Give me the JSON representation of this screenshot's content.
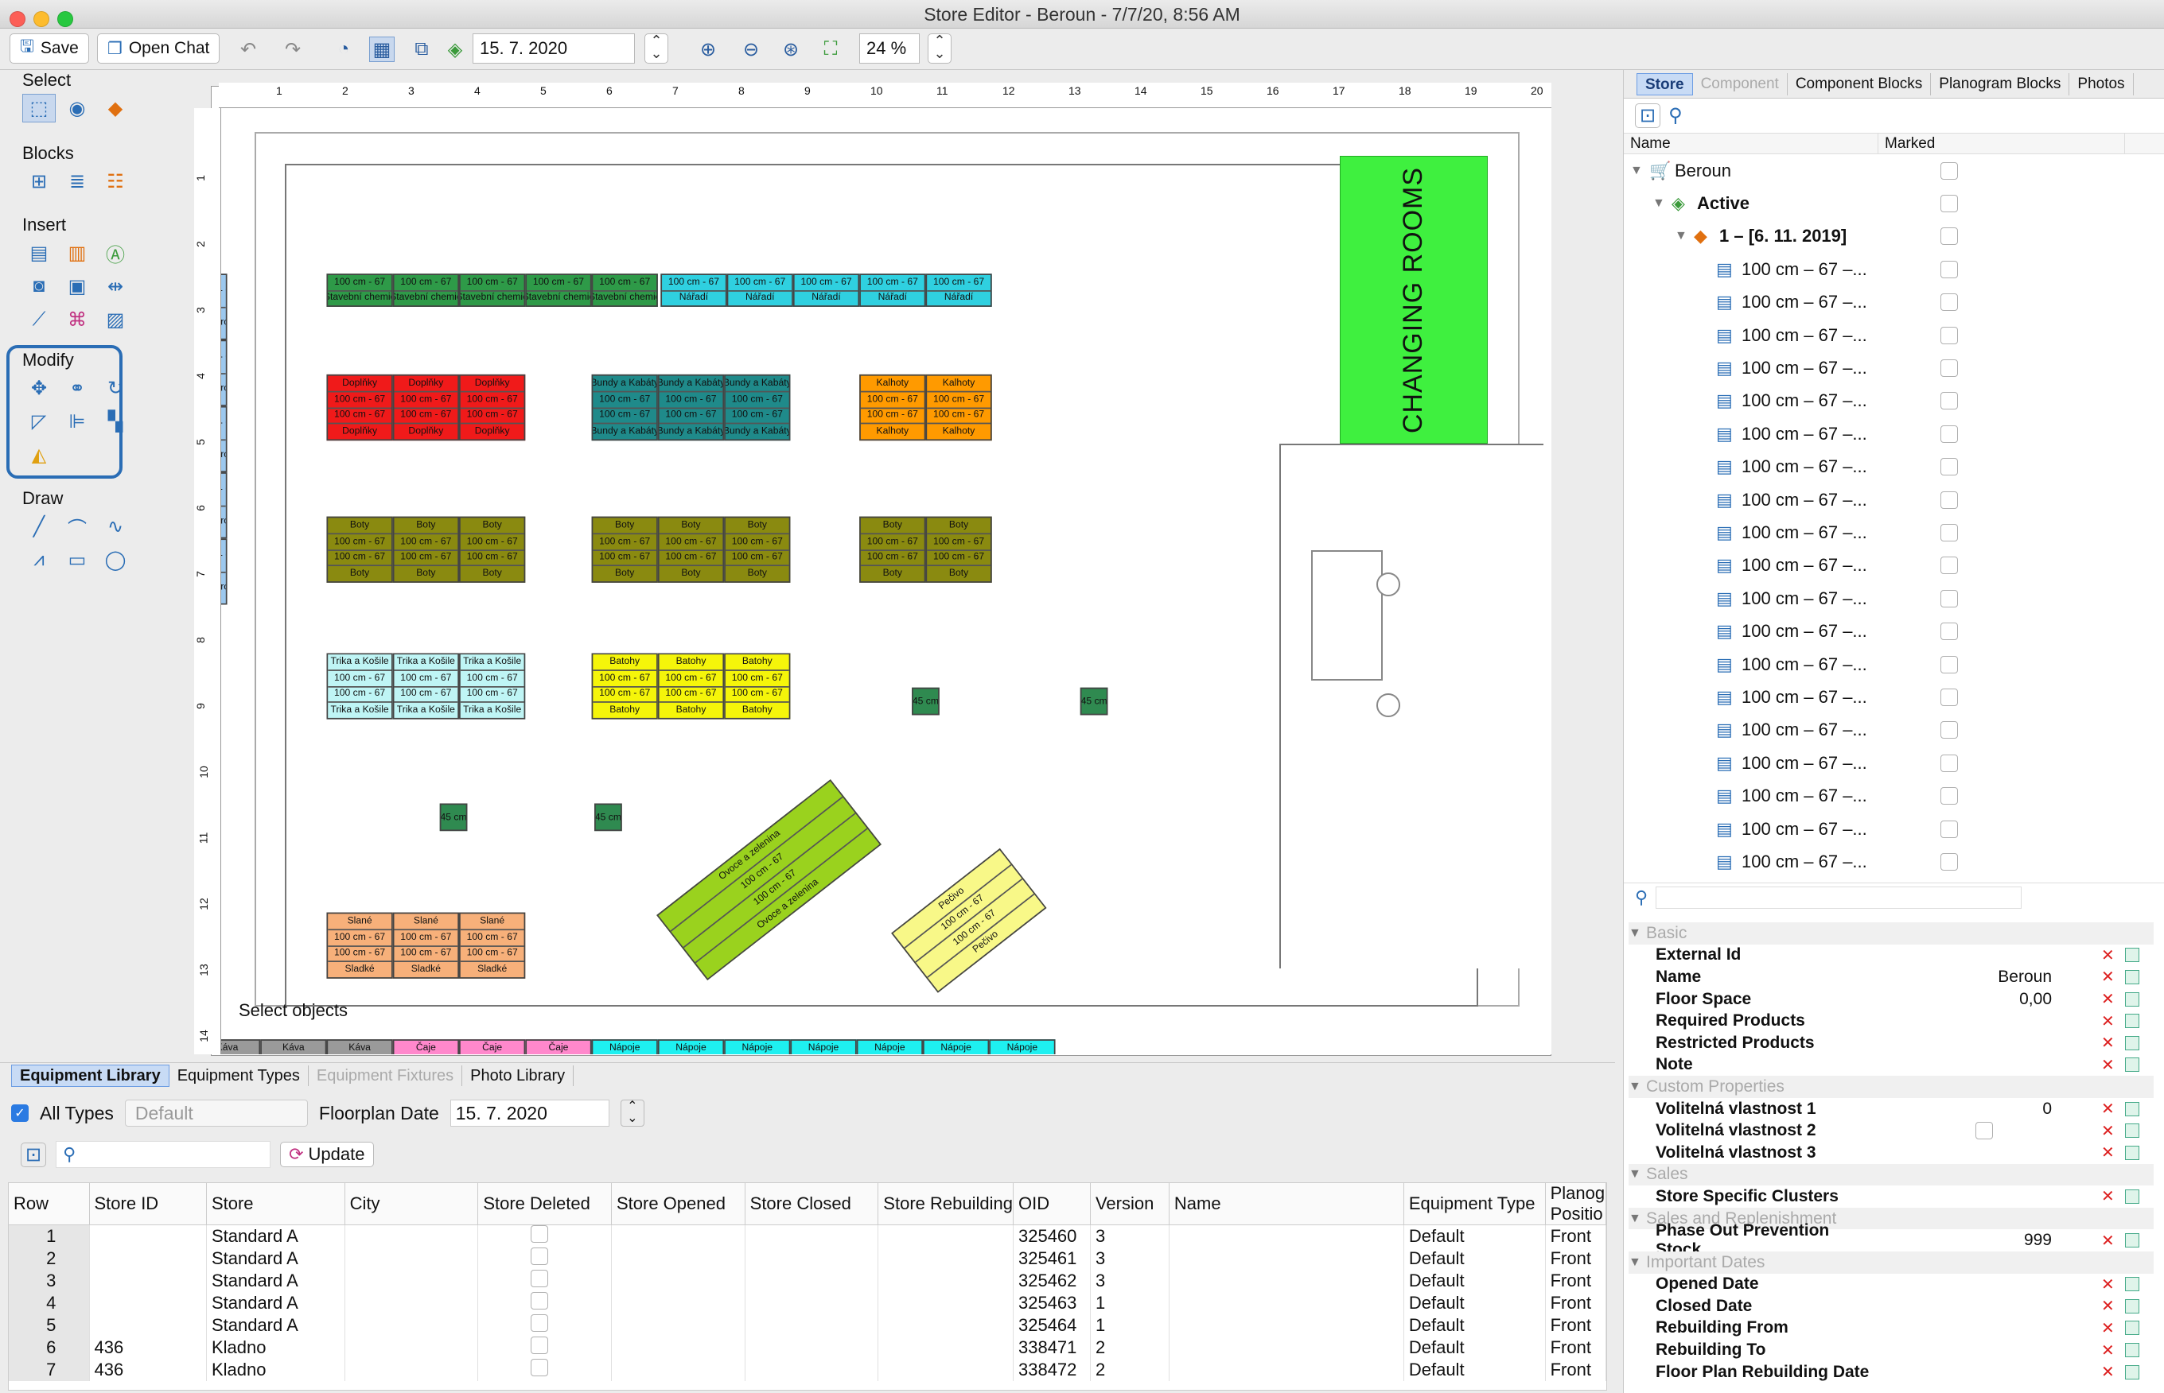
{
  "window": {
    "title": "Store Editor - Beroun - 7/7/20, 8:56 AM"
  },
  "toolbar": {
    "save": "Save",
    "open_chat": "Open Chat",
    "date": "15. 7. 2020",
    "zoom": "24 %"
  },
  "palette": {
    "select": "Select",
    "blocks": "Blocks",
    "insert": "Insert",
    "modify": "Modify",
    "draw": "Draw"
  },
  "canvas": {
    "status": "Select objects",
    "changing_rooms": "CHANGING ROOMS",
    "ruler_top": [
      "1",
      "2",
      "3",
      "4",
      "5",
      "6",
      "7",
      "8",
      "9",
      "10",
      "11",
      "12",
      "13",
      "14",
      "15",
      "16",
      "17",
      "18",
      "19",
      "20"
    ],
    "ruler_left": [
      "1",
      "2",
      "3",
      "4",
      "5",
      "6",
      "7",
      "8",
      "9",
      "10",
      "11",
      "12",
      "13",
      "14"
    ],
    "fixture_label": "100 cm - 67",
    "groups": {
      "chemie": "Stavební chemie",
      "naradi": "Nářadí",
      "doplnky": "Doplňky",
      "bundy": "Bundy a Kabáty",
      "kalhoty": "Kalhoty",
      "boty": "Boty",
      "trika": "Trika a Košile",
      "batohy": "Batohy",
      "slane": "Slané",
      "sladke": "Sladké",
      "kava": "Káva",
      "caje": "Čaje",
      "napoje": "Nápoje",
      "pecivo": "Pečivo",
      "ovoce": "Ovoce a zelenina",
      "mlecne": "Mléčné výrobky",
      "small": "45 cm"
    }
  },
  "right": {
    "tabs": [
      "Store",
      "Component",
      "Component Blocks",
      "Planogram Blocks",
      "Photos"
    ],
    "tree_cols": [
      "Name",
      "Marked"
    ],
    "tree": {
      "root": "Beroun",
      "active": "Active",
      "plan": "1 – [6. 11. 2019]",
      "item": "100 cm – 67 –..."
    },
    "props": [
      {
        "label": "Basic",
        "section": true
      },
      {
        "label": "External Id",
        "value": ""
      },
      {
        "label": "Name",
        "value": "Beroun"
      },
      {
        "label": "Floor Space",
        "value": "0,00"
      },
      {
        "label": "Required Products",
        "value": ""
      },
      {
        "label": "Restricted Products",
        "value": ""
      },
      {
        "label": "Note",
        "value": ""
      },
      {
        "label": "Custom Properties",
        "section": true
      },
      {
        "label": "Volitelná vlastnost 1",
        "value": "0"
      },
      {
        "label": "Volitelná vlastnost 2",
        "value": ""
      },
      {
        "label": "Volitelná vlastnost 3",
        "value": ""
      },
      {
        "label": "Sales",
        "section": true
      },
      {
        "label": "Store Specific Clusters",
        "value": ""
      },
      {
        "label": "Sales and Replenishment",
        "section": true
      },
      {
        "label": "Phase Out Prevention Stock",
        "value": "999"
      },
      {
        "label": "Important Dates",
        "section": true
      },
      {
        "label": "Opened Date",
        "value": ""
      },
      {
        "label": "Closed Date",
        "value": ""
      },
      {
        "label": "Rebuilding From",
        "value": ""
      },
      {
        "label": "Rebuilding To",
        "value": ""
      },
      {
        "label": "Floor Plan Rebuilding Date",
        "value": ""
      }
    ]
  },
  "bottom": {
    "tabs": [
      "Equipment Library",
      "Equipment Types",
      "Equipment Fixtures",
      "Photo Library"
    ],
    "all_types": "All Types",
    "default": "Default",
    "floorplan_date_label": "Floorplan Date",
    "floorplan_date": "15. 7. 2020",
    "update": "Update",
    "columns": [
      "Row",
      "Store ID",
      "Store",
      "City",
      "Store Deleted",
      "Store Opened",
      "Store Closed",
      "Store Rebuilding",
      "OID",
      "Version",
      "Name",
      "Equipment Type",
      "Planog Positio"
    ],
    "rows": [
      {
        "row": "1",
        "store_id": "",
        "store": "Standard A",
        "oid": "325460",
        "version": "3",
        "type": "Default",
        "pos": "Front"
      },
      {
        "row": "2",
        "store_id": "",
        "store": "Standard A",
        "oid": "325461",
        "version": "3",
        "type": "Default",
        "pos": "Front"
      },
      {
        "row": "3",
        "store_id": "",
        "store": "Standard A",
        "oid": "325462",
        "version": "3",
        "type": "Default",
        "pos": "Front"
      },
      {
        "row": "4",
        "store_id": "",
        "store": "Standard A",
        "oid": "325463",
        "version": "1",
        "type": "Default",
        "pos": "Front"
      },
      {
        "row": "5",
        "store_id": "",
        "store": "Standard A",
        "oid": "325464",
        "version": "1",
        "type": "Default",
        "pos": "Front"
      },
      {
        "row": "6",
        "store_id": "436",
        "store": "Kladno",
        "oid": "338471",
        "version": "2",
        "type": "Default",
        "pos": "Front"
      },
      {
        "row": "7",
        "store_id": "436",
        "store": "Kladno",
        "oid": "338472",
        "version": "2",
        "type": "Default",
        "pos": "Front"
      }
    ]
  },
  "colors": {
    "accent": "#2a6db5",
    "changing": "#3ff03f",
    "chemie": "#2e9a48",
    "naradi": "#2fd0e0",
    "doplnky": "#f01a1a",
    "bundy": "#1f8a8a",
    "kalhoty": "#ff9a00",
    "boty": "#8a8a10",
    "trika": "#bff5f5",
    "batohy": "#f5f50a",
    "slane": "#f7b07a",
    "sladke": "#2f9a50",
    "kava": "#9a9a9a",
    "caje": "#ff88cc",
    "napoje": "#1ef0f0",
    "pecivo": "#f8f888",
    "ovoce": "#9ad21e",
    "mlecne": "#9cc8ee",
    "small": "#2f8a50"
  }
}
